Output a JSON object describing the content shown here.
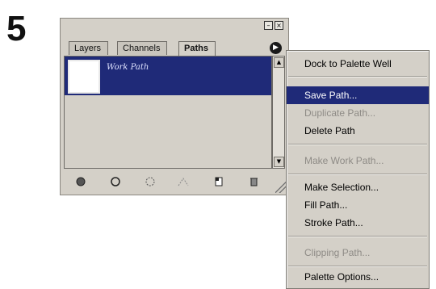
{
  "step_number": "5",
  "palette": {
    "tabs": [
      "Layers",
      "Channels",
      "Paths"
    ],
    "active_tab": "Paths",
    "paths": [
      {
        "name": "Work Path"
      }
    ]
  },
  "menu": {
    "items": [
      {
        "label": "Dock to Palette Well",
        "enabled": true
      },
      {
        "label": "Save Path...",
        "enabled": true,
        "highlighted": true
      },
      {
        "label": "Duplicate Path...",
        "enabled": false
      },
      {
        "label": "Delete Path",
        "enabled": true
      },
      {
        "label": "Make Work Path...",
        "enabled": false
      },
      {
        "label": "Make Selection...",
        "enabled": true
      },
      {
        "label": "Fill Path...",
        "enabled": true
      },
      {
        "label": "Stroke Path...",
        "enabled": true
      },
      {
        "label": "Clipping Path...",
        "enabled": false
      },
      {
        "label": "Palette Options...",
        "enabled": true
      }
    ]
  },
  "colors": {
    "highlight": "#1f2a78",
    "panel": "#d4d0c8",
    "disabled_text": "#8e8b86"
  }
}
